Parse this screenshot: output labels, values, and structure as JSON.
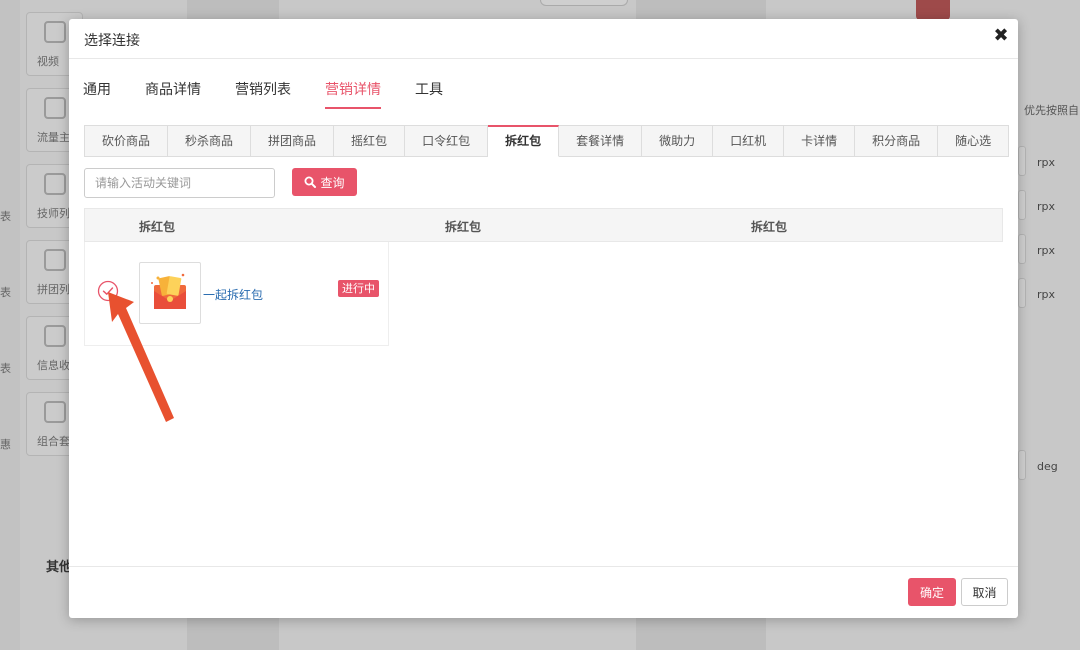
{
  "background": {
    "sidebar_tiles": [
      {
        "label": "视频"
      },
      {
        "label": "流量主"
      },
      {
        "label": "技师列"
      },
      {
        "label": "拼团列"
      },
      {
        "label": "信息收"
      },
      {
        "label": "组合套"
      }
    ],
    "edge_text": [
      "表",
      "表",
      "表",
      "惠"
    ],
    "other_label": "其他",
    "right_label": "优先按照自",
    "units": [
      "rpx",
      "rpx",
      "rpx",
      "rpx",
      "deg"
    ]
  },
  "modal": {
    "title": "选择连接",
    "close_glyph": "✖",
    "main_tabs": [
      {
        "label": "通用",
        "active": false
      },
      {
        "label": "商品详情",
        "active": false
      },
      {
        "label": "营销列表",
        "active": false
      },
      {
        "label": "营销详情",
        "active": true
      },
      {
        "label": "工具",
        "active": false
      }
    ],
    "sub_tabs": [
      {
        "label": "砍价商品",
        "active": false
      },
      {
        "label": "秒杀商品",
        "active": false
      },
      {
        "label": "拼团商品",
        "active": false
      },
      {
        "label": "摇红包",
        "active": false
      },
      {
        "label": "口令红包",
        "active": false
      },
      {
        "label": "拆红包",
        "active": true
      },
      {
        "label": "套餐详情",
        "active": false
      },
      {
        "label": "微助力",
        "active": false
      },
      {
        "label": "口红机",
        "active": false
      },
      {
        "label": "卡详情",
        "active": false
      },
      {
        "label": "积分商品",
        "active": false
      },
      {
        "label": "随心选",
        "active": false
      }
    ],
    "search": {
      "placeholder": "请输入活动关键词",
      "value": "",
      "button_label": "查询",
      "button_icon": "search-icon"
    },
    "table": {
      "headers": [
        "拆红包",
        "拆红包",
        "拆红包"
      ],
      "items": [
        {
          "name": "一起拆红包",
          "status": "进行中",
          "selected": true,
          "thumb_icon": "red-envelope-icon"
        }
      ]
    },
    "footer": {
      "ok_label": "确定",
      "cancel_label": "取消"
    }
  },
  "colors": {
    "accent": "#e8546a",
    "link": "#2a6cb0",
    "annotation_arrow": "#e8512f"
  }
}
